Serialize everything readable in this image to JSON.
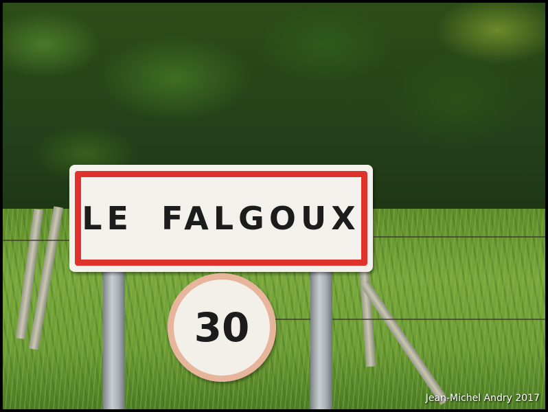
{
  "sign": {
    "town_name": "LE FALGOUX"
  },
  "speed_sign": {
    "limit": "30"
  },
  "caption": {
    "credit": "Jean-Michel Andry 2017"
  },
  "colors": {
    "sign_border": "#e0322c",
    "sign_background": "#f4f1ec",
    "text": "#1c1c1c",
    "vegetation": "#3d6a20"
  }
}
